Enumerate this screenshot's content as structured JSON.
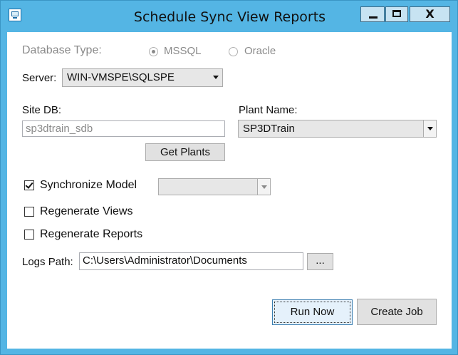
{
  "window": {
    "title": "Schedule Sync View Reports",
    "close_glyph": "X"
  },
  "database_type": {
    "label": "Database Type:",
    "options": [
      {
        "label": "MSSQL",
        "selected": true
      },
      {
        "label": "Oracle",
        "selected": false
      }
    ]
  },
  "server": {
    "label": "Server:",
    "value": "WIN-VMSPE\\SQLSPE"
  },
  "site_db": {
    "label": "Site DB:",
    "value": "sp3dtrain_sdb"
  },
  "plant_name": {
    "label": "Plant Name:",
    "value": "SP3DTrain"
  },
  "get_plants_label": "Get Plants",
  "synchronize_model": {
    "label": "Synchronize Model",
    "checked": true,
    "combo_value": ""
  },
  "regenerate_views": {
    "label": "Regenerate Views",
    "checked": false
  },
  "regenerate_reports": {
    "label": "Regenerate Reports",
    "checked": false
  },
  "logs_path": {
    "label": "Logs Path:",
    "value": "C:\\Users\\Administrator\\Documents",
    "browse_label": "..."
  },
  "run_now_label": "Run Now",
  "create_job_label": "Create Job",
  "colors": {
    "titlebar": "#54b5e4",
    "button_face": "#e1e1e1",
    "disabled_text": "#8a8a8a"
  }
}
